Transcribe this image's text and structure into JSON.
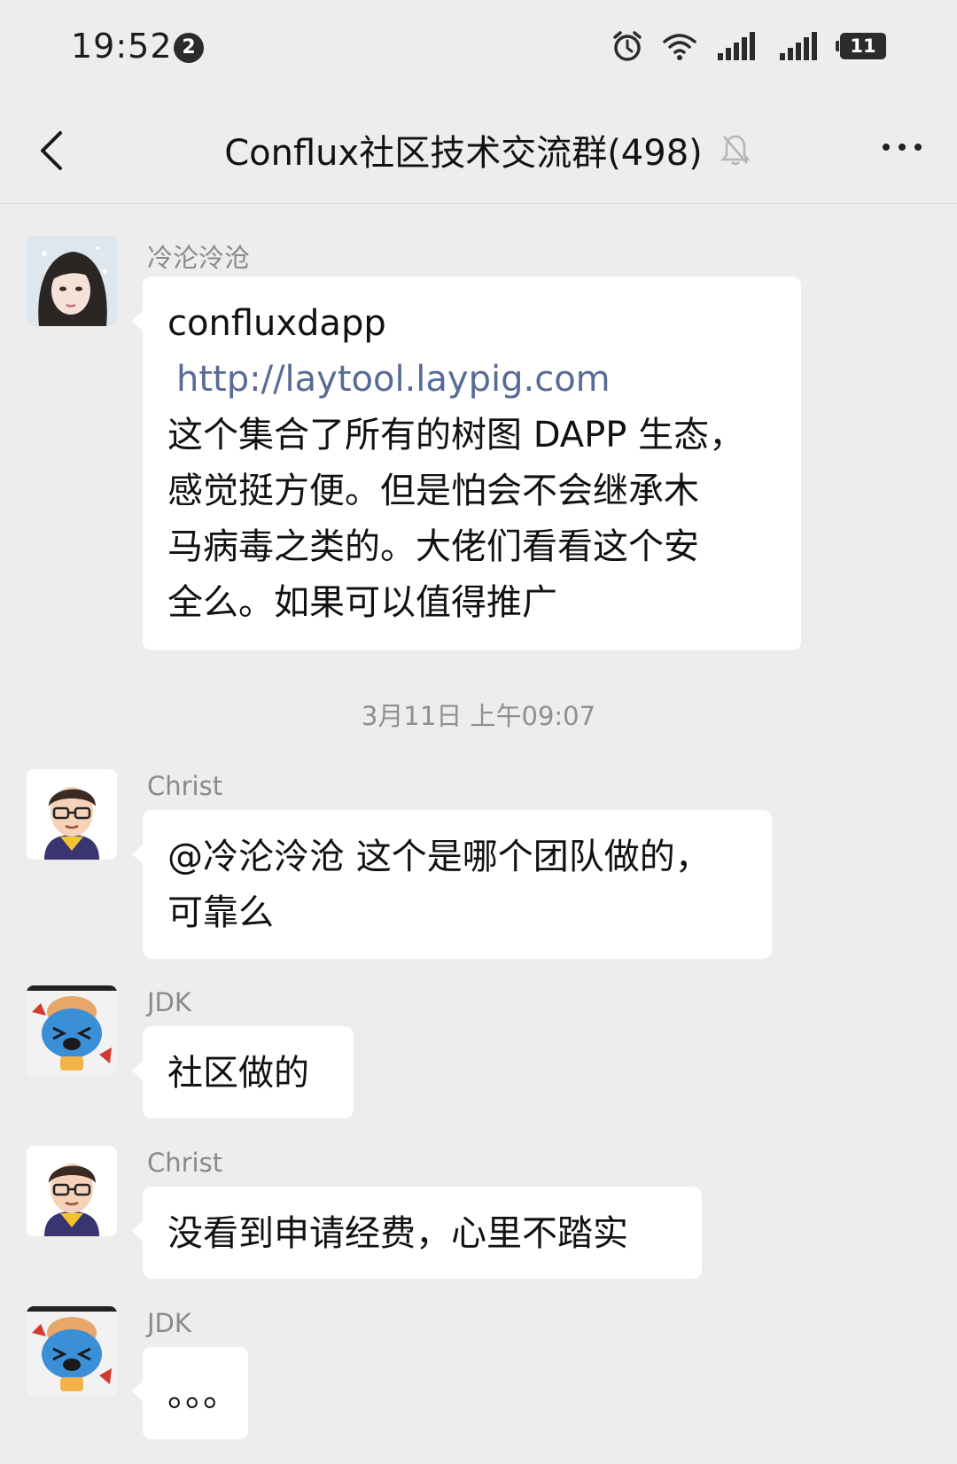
{
  "status_bar": {
    "time": "19:52",
    "notification_count": "2",
    "battery": "11",
    "icons": [
      "alarm-icon",
      "wifi-icon",
      "signal-1-icon",
      "signal-2-icon",
      "battery-icon"
    ]
  },
  "nav": {
    "title": "Conflux社区技术交流群(498)",
    "back_icon": "chevron-left-icon",
    "mute_icon": "bell-muted-icon",
    "more_icon": "more-dots-icon"
  },
  "messages": [
    {
      "sender": "冷沦泠沧",
      "lines": [
        "confluxdapp",
        "http://laytool.laypig.com",
        "这个集合了所有的树图 DAPP 生态，",
        "感觉挺方便。但是怕会不会继承木",
        "马病毒之类的。大佬们看看这个安",
        "全么。如果可以值得推广"
      ]
    },
    {
      "sender": "Christ",
      "lines": [
        "@冷沦泠沧  这个是哪个团队做的，",
        "可靠么"
      ]
    },
    {
      "sender": "JDK",
      "lines": [
        "社区做的"
      ]
    },
    {
      "sender": "Christ",
      "lines": [
        "没看到申请经费，心里不踏实"
      ]
    },
    {
      "sender": "JDK",
      "lines": [
        "。。。"
      ]
    }
  ],
  "timestamp": "3月11日 上午09:07",
  "colors": {
    "background": "#ededed",
    "bubble": "#ffffff",
    "link": "#576b95",
    "sender": "#8a8a8a"
  }
}
